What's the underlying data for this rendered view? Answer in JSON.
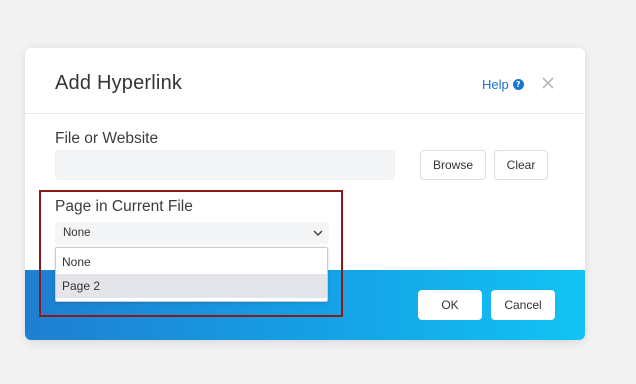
{
  "dialog": {
    "title": "Add Hyperlink",
    "help_label": "Help",
    "help_icon": "question-circle-icon",
    "close_icon": "close-x-icon"
  },
  "file_or_website": {
    "label": "File or Website",
    "input_value": "",
    "browse_label": "Browse",
    "clear_label": "Clear"
  },
  "page_in_file": {
    "label": "Page in Current File",
    "selected_value": "None",
    "options": [
      "None",
      "Page 2"
    ],
    "highlighted_option": "Page 2"
  },
  "footer": {
    "ok_label": "OK",
    "cancel_label": "Cancel"
  },
  "colors": {
    "accent": "#1a73d8",
    "footer_gradient_start": "#1e7fd0",
    "footer_gradient_end": "#12c3f4",
    "annotation_box": "#8b1a16"
  }
}
